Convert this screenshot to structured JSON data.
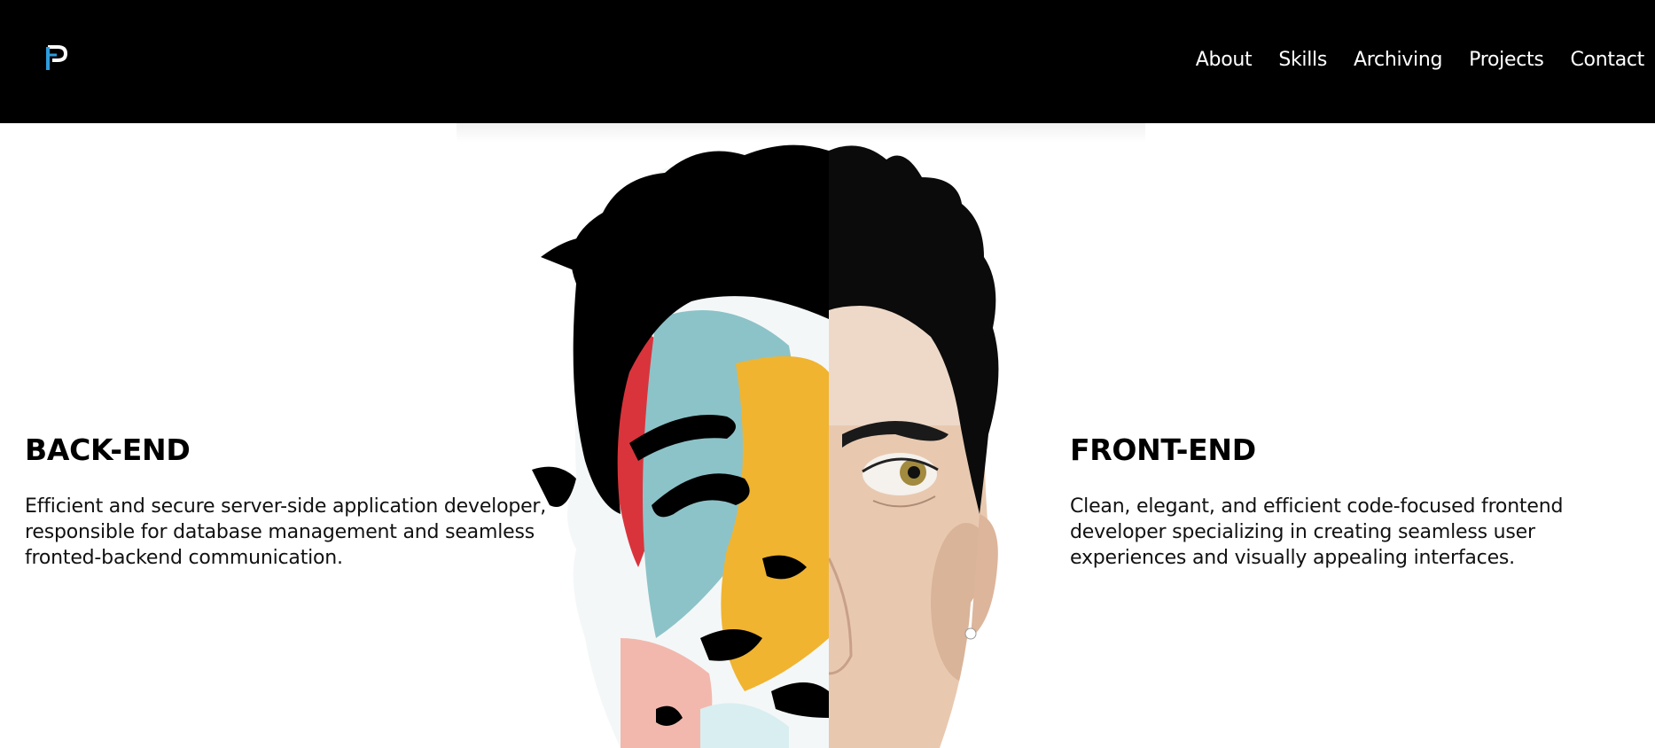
{
  "nav": {
    "logo_icon": "p-monogram-logo",
    "items": [
      {
        "label": "About"
      },
      {
        "label": "Skills"
      },
      {
        "label": "Archiving"
      },
      {
        "label": "Projects"
      },
      {
        "label": "Contact"
      }
    ]
  },
  "hero": {
    "image": "split-face-portrait",
    "backend": {
      "title": "BACK-END",
      "description": "Efficient and secure server-side application developer, responsible for database management and seamless fronted-backend communication."
    },
    "frontend": {
      "title": "FRONT-END",
      "description": "Clean, elegant, and efficient code-focused frontend developer specializing in creating seamless user experiences and visually appealing interfaces."
    }
  },
  "colors": {
    "header_bg": "#000000",
    "logo_blue": "#2d9cdb",
    "logo_white": "#ffffff",
    "paint_red": "#d9343b",
    "paint_teal": "#8cc3c8",
    "paint_yellow": "#f0b431",
    "skin": "#e8c9b0"
  }
}
